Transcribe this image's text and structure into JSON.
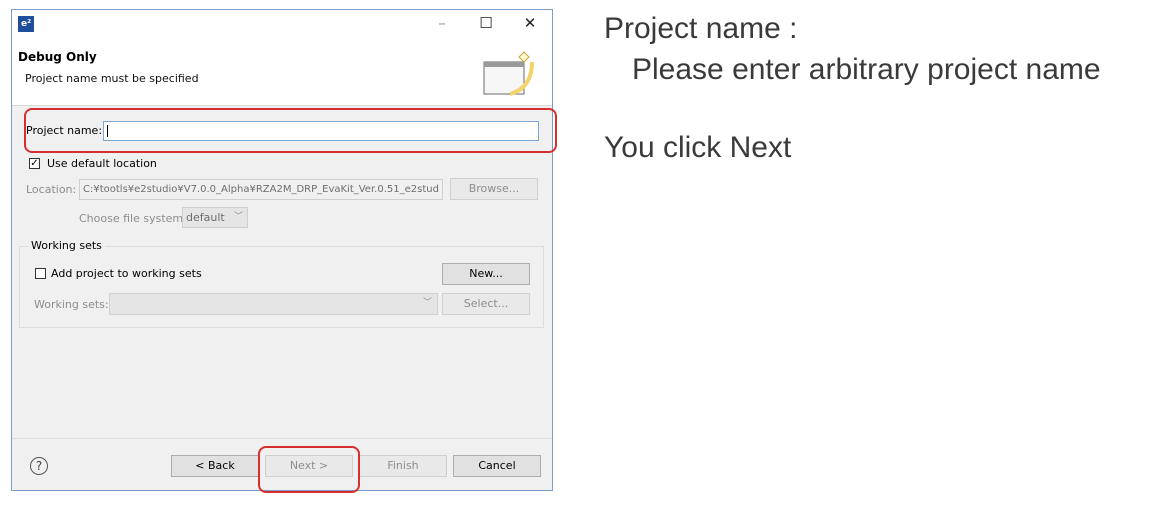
{
  "dialog": {
    "app_icon": "e²",
    "header_title": "Debug Only",
    "header_message": "Project name must be specified",
    "window_buttons": {
      "minimize": "–",
      "maximize": "☐",
      "close": "✕"
    }
  },
  "form": {
    "project_name_label": "Project name:",
    "project_name_value": "",
    "use_default_location_label": "Use default location",
    "use_default_location_checked": true,
    "location_label": "Location:",
    "location_value": "C:¥tootls¥e2studio¥V7.0.0_Alpha¥RZA2M_DRP_EvaKit_Ver.0.51_e2stud",
    "browse_label": "Browse...",
    "file_system_label": "Choose file system:",
    "file_system_value": "default",
    "working_sets_group": "Working sets",
    "add_to_working_sets_label": "Add project to working sets",
    "add_to_working_sets_checked": false,
    "new_label": "New...",
    "working_sets_label": "Working sets:",
    "working_sets_value": "",
    "select_label": "Select..."
  },
  "footer": {
    "help_icon": "?",
    "back_label": "< Back",
    "next_label": "Next >",
    "finish_label": "Finish",
    "cancel_label": "Cancel"
  },
  "notes": {
    "line1": "Project name :",
    "line2": "Please enter arbitrary project name",
    "line3": "You click Next"
  },
  "colors": {
    "highlight": "#d62f2f",
    "focus_border": "#7aa7d4",
    "window_border": "#7a9cc6"
  }
}
